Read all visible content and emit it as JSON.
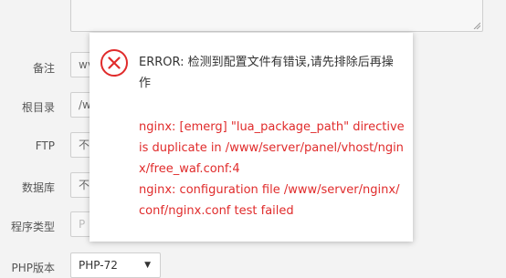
{
  "form": {
    "labels": {
      "note": "备注",
      "root_dir": "根目录",
      "ftp": "FTP",
      "database": "数据库",
      "program_type": "程序类型",
      "php_version": "PHP版本"
    },
    "values": {
      "note": "wv",
      "root_dir": "/w",
      "ftp": "不",
      "database": "不",
      "program_type": "P",
      "php_version": "PHP-72"
    }
  },
  "dialog": {
    "icon": "error-circle-x-icon",
    "title": "ERROR: 检测到配置文件有错误,请先排除后再操作",
    "detail_lines": [
      "nginx: [emerg] \"lua_package_path\" directive is duplicate in /www/server/panel/vhost/nginx/free_waf.conf:4",
      "nginx: configuration file /www/server/nginx/conf/nginx.conf test failed"
    ]
  },
  "colors": {
    "error_red": "#e02b2b",
    "page_bg": "#f3f3f3"
  }
}
